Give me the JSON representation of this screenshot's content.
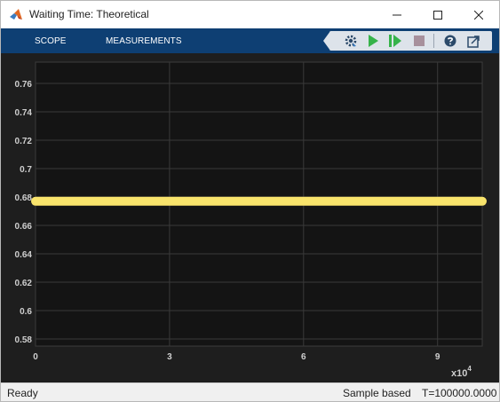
{
  "window": {
    "title": "Waiting Time: Theoretical",
    "controls": [
      "minimize-icon",
      "maximize-icon",
      "close-icon"
    ]
  },
  "toolstrip": {
    "tabs": [
      "SCOPE",
      "MEASUREMENTS"
    ],
    "tools": [
      "settings-gear-icon",
      "run-icon",
      "step-forward-icon",
      "stop-icon",
      "help-icon",
      "undock-icon"
    ]
  },
  "colors": {
    "toolstrip": "#0e3f73",
    "plot_background": "#141414",
    "frame_background": "#1e1e1e",
    "series": "#f9e46c"
  },
  "chart_data": {
    "type": "line",
    "title": "",
    "xlabel": "",
    "ylabel": "",
    "x_exponent_label": "x10",
    "x_exponent_power": "4",
    "xlim": [
      0,
      100000
    ],
    "ylim": [
      0.575,
      0.775
    ],
    "xticks": [
      0,
      30000,
      60000,
      90000
    ],
    "xtick_labels": [
      "0",
      "3",
      "6",
      "9"
    ],
    "yticks": [
      0.58,
      0.6,
      0.62,
      0.64,
      0.66,
      0.68,
      0.7,
      0.72,
      0.74,
      0.76
    ],
    "ytick_labels": [
      "0.58",
      "0.6",
      "0.62",
      "0.64",
      "0.66",
      "0.68",
      "0.7",
      "0.72",
      "0.74",
      "0.76"
    ],
    "grid": true,
    "series": [
      {
        "x": [
          0,
          100000
        ],
        "values": [
          0.677,
          0.677
        ]
      }
    ]
  },
  "status": {
    "state": "Ready",
    "mode": "Sample based",
    "time": "T=100000.0000"
  }
}
